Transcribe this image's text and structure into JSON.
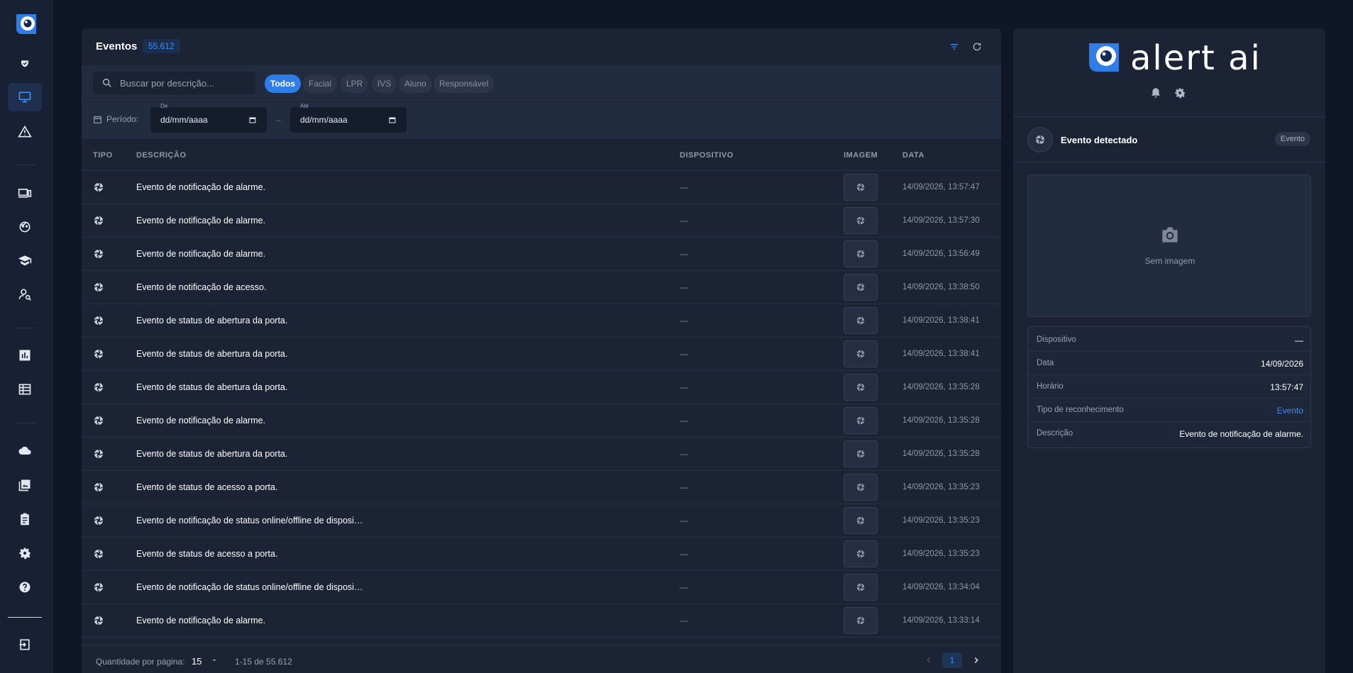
{
  "sidebar": {
    "items": [
      {
        "icon": "shield-check-icon"
      },
      {
        "icon": "monitor-icon",
        "active": true
      },
      {
        "icon": "warning-icon"
      },
      {
        "icon": "devices-icon"
      },
      {
        "icon": "face-icon"
      },
      {
        "icon": "school-icon"
      },
      {
        "icon": "person-search-icon"
      },
      {
        "icon": "bar-chart-icon"
      },
      {
        "icon": "table-icon"
      },
      {
        "icon": "cloud-icon"
      },
      {
        "icon": "gallery-icon"
      },
      {
        "icon": "clipboard-icon"
      },
      {
        "icon": "gear-icon"
      },
      {
        "icon": "help-icon"
      },
      {
        "icon": "logout-icon"
      }
    ]
  },
  "events": {
    "title": "Eventos",
    "count": "55.612",
    "search_placeholder": "Buscar por descrição...",
    "filters": [
      "Todos",
      "Facial",
      "LPR",
      "IVS",
      "Aluno",
      "Responsável"
    ],
    "active_filter": "Todos",
    "period_label": "Período:",
    "date_from_label": "De",
    "date_from_value": "dd/mm/aaaa",
    "date_to_label": "Até",
    "date_to_value": "dd/mm/aaaa",
    "dash": "–",
    "columns": {
      "tipo": "TIPO",
      "descricao": "DESCRIÇÃO",
      "dispositivo": "DISPOSITIVO",
      "imagem": "IMAGEM",
      "data": "DATA"
    },
    "rows": [
      {
        "desc": "Evento de notificação de alarme.",
        "device": "—",
        "date": "14/09/2026, 13:57:47"
      },
      {
        "desc": "Evento de notificação de alarme.",
        "device": "—",
        "date": "14/09/2026, 13:57:30"
      },
      {
        "desc": "Evento de notificação de alarme.",
        "device": "—",
        "date": "14/09/2026, 13:56:49"
      },
      {
        "desc": "Evento de notificação de acesso.",
        "device": "—",
        "date": "14/09/2026, 13:38:50"
      },
      {
        "desc": "Evento de status de abertura da porta.",
        "device": "—",
        "date": "14/09/2026, 13:38:41"
      },
      {
        "desc": "Evento de status de abertura da porta.",
        "device": "—",
        "date": "14/09/2026, 13:38:41"
      },
      {
        "desc": "Evento de status de abertura da porta.",
        "device": "—",
        "date": "14/09/2026, 13:35:28"
      },
      {
        "desc": "Evento de notificação de alarme.",
        "device": "—",
        "date": "14/09/2026, 13:35:28"
      },
      {
        "desc": "Evento de status de abertura da porta.",
        "device": "—",
        "date": "14/09/2026, 13:35:28"
      },
      {
        "desc": "Evento de status de acesso a porta.",
        "device": "—",
        "date": "14/09/2026, 13:35:23"
      },
      {
        "desc": "Evento de notificação de status online/offline de disposi…",
        "device": "—",
        "date": "14/09/2026, 13:35:23"
      },
      {
        "desc": "Evento de status de acesso a porta.",
        "device": "—",
        "date": "14/09/2026, 13:35:23"
      },
      {
        "desc": "Evento de notificação de status online/offline de disposi…",
        "device": "—",
        "date": "14/09/2026, 13:34:04"
      },
      {
        "desc": "Evento de notificação de alarme.",
        "device": "—",
        "date": "14/09/2026, 13:33:14"
      }
    ],
    "pager": {
      "qty_label": "Quantidade por página:",
      "qty_value": "15",
      "range": "1-15 de 55.612",
      "page": "1"
    }
  },
  "detail": {
    "brand": "alert ai",
    "event_title": "Evento detectado",
    "event_badge": "Evento",
    "no_image": "Sem imagem",
    "info": [
      {
        "k": "Dispositivo",
        "v": "—"
      },
      {
        "k": "Data",
        "v": "14/09/2026"
      },
      {
        "k": "Horário",
        "v": "13:57:47"
      },
      {
        "k": "Tipo de reconhecimento",
        "v": "Evento",
        "accent": true
      },
      {
        "k": "Descrição",
        "v": "Evento de notificação de alarme."
      }
    ]
  },
  "colors": {
    "accent": "#2f7ee8",
    "background": "#0f1726",
    "panel": "#1b2335"
  }
}
